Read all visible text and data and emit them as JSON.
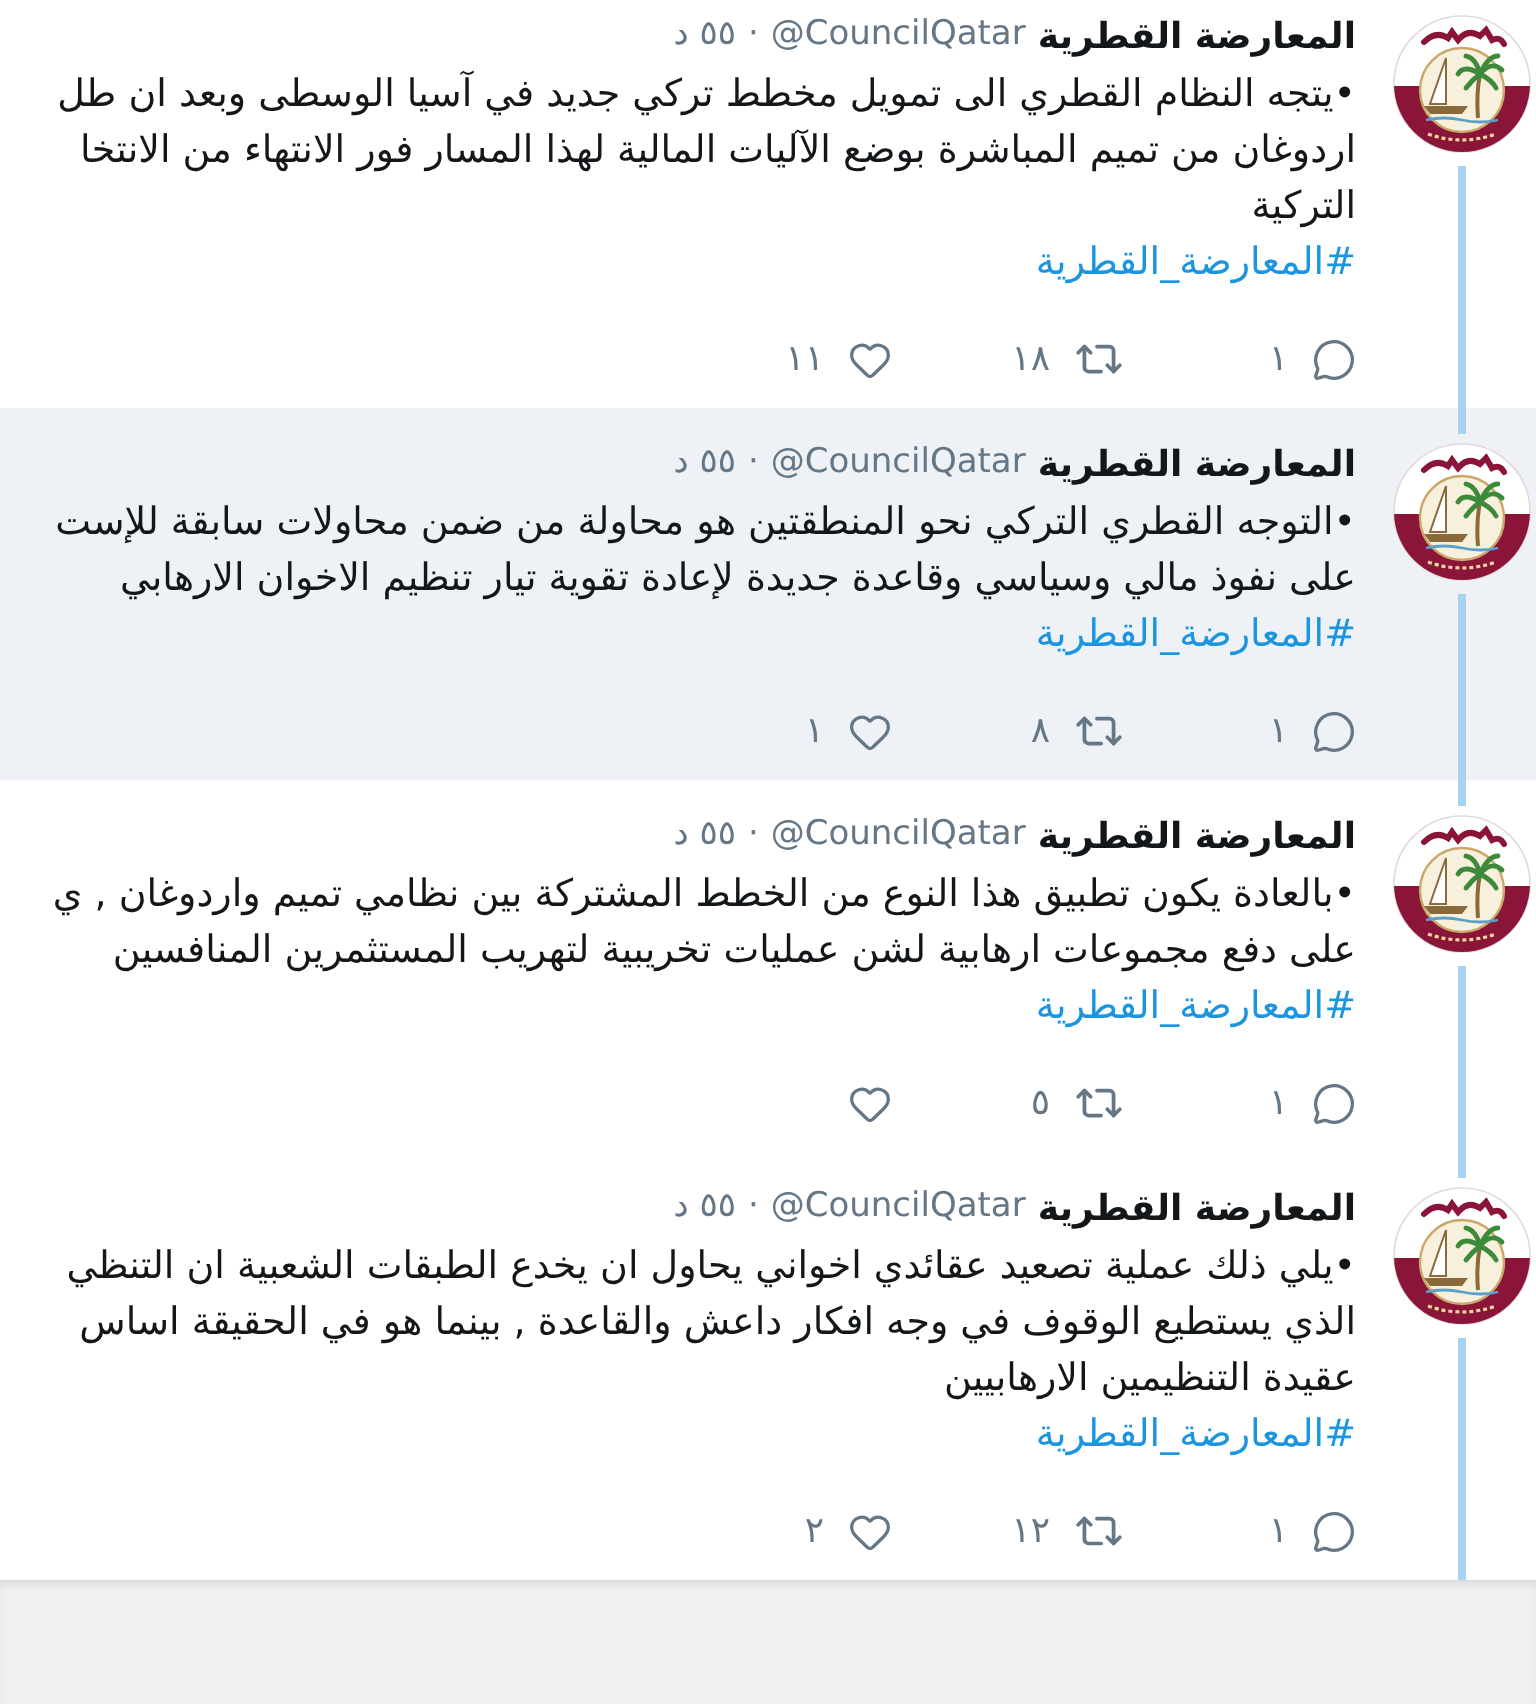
{
  "tweets": [
    {
      "author": "المعارضة القطرية",
      "handle": "@CouncilQatar",
      "separator": "·",
      "time": "٥٥ د",
      "highlighted": false,
      "text_lines": [
        "•يتجه النظام القطري الى تمويل مخطط تركي جديد في  آسيا الوسطى وبعد ان طل",
        "اردوغان من تميم المباشرة بوضع الآليات المالية لهذا المسار  فور الانتهاء من الانتخا",
        "التركية"
      ],
      "hashtag": "#المعارضة_القطرية",
      "replies": "١",
      "retweets": "١٨",
      "likes": "١١"
    },
    {
      "author": "المعارضة القطرية",
      "handle": "@CouncilQatar",
      "separator": "·",
      "time": "٥٥ د",
      "highlighted": true,
      "text_lines": [
        "•التوجه القطري التركي نحو المنطقتين هو محاولة من ضمن محاولات سابقة للإست",
        "على نفوذ مالي وسياسي وقاعدة جديدة لإعادة تقوية تيار تنظيم الاخوان الارهابي"
      ],
      "hashtag": "#المعارضة_القطرية",
      "replies": "١",
      "retweets": "٨",
      "likes": "١"
    },
    {
      "author": "المعارضة القطرية",
      "handle": "@CouncilQatar",
      "separator": "·",
      "time": "٥٥ د",
      "highlighted": false,
      "text_lines": [
        "•بالعادة يكون تطبيق هذا النوع من  الخطط المشتركة بين نظامي تميم واردوغان , ي",
        "على دفع مجموعات ارهابية لشن عمليات تخريبية لتهريب المستثمرين المنافسين"
      ],
      "hashtag": "#المعارضة_القطرية",
      "replies": "١",
      "retweets": "٥"
    },
    {
      "author": "المعارضة القطرية",
      "handle": "@CouncilQatar",
      "separator": "·",
      "time": "٥٥ د",
      "highlighted": false,
      "text_lines": [
        "•يلي ذلك عملية تصعيد عقائدي اخواني يحاول ان يخدع الطبقات الشعبية ان التنظي",
        "الذي يستطيع الوقوف في وجه افكار داعش والقاعدة , بينما هو في الحقيقة  اساس",
        "عقيدة التنظيمين الارهابيين"
      ],
      "hashtag": "#المعارضة_القطرية",
      "replies": "١",
      "retweets": "١٢",
      "likes": "٢"
    }
  ]
}
